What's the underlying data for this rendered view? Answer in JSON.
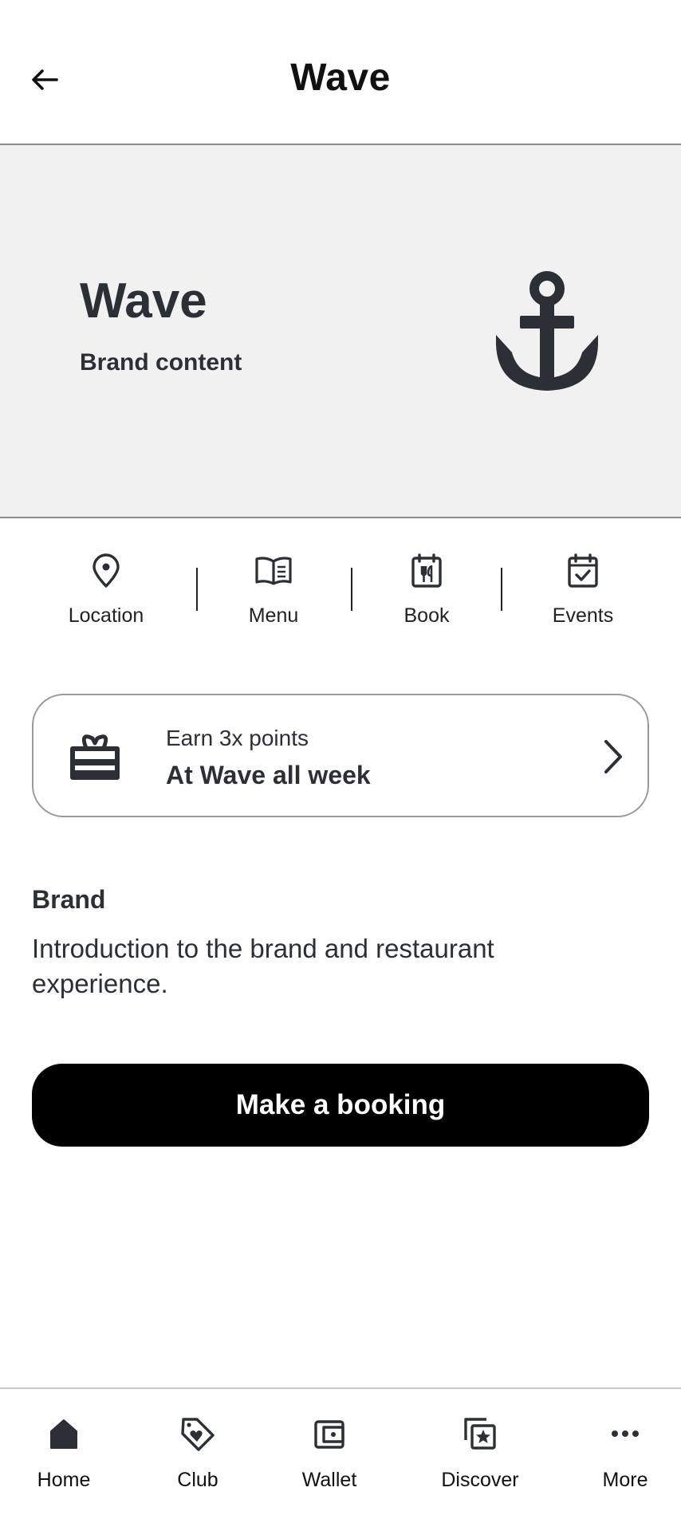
{
  "header": {
    "title": "Wave",
    "back_icon": "arrow-left-icon"
  },
  "hero": {
    "title": "Wave",
    "subtitle": "Brand content",
    "icon": "anchor-icon",
    "background": "#f1f1f1"
  },
  "actions": [
    {
      "label": "Location",
      "icon": "map-pin-icon"
    },
    {
      "label": "Menu",
      "icon": "open-book-icon"
    },
    {
      "label": "Book",
      "icon": "calendar-cutlery-icon"
    },
    {
      "label": "Events",
      "icon": "calendar-check-icon"
    }
  ],
  "promo": {
    "line1": "Earn 3x points",
    "line2": "At Wave all week",
    "icon": "gift-card-icon",
    "chevron_icon": "chevron-right-icon"
  },
  "brand_section": {
    "heading": "Brand",
    "body": "Introduction to the brand and restaurant experience."
  },
  "booking_button": {
    "label": "Make a booking",
    "background": "#000000"
  },
  "bottom_nav": [
    {
      "label": "Home",
      "icon": "home-icon"
    },
    {
      "label": "Club",
      "icon": "heart-tag-icon"
    },
    {
      "label": "Wallet",
      "icon": "wallet-icon"
    },
    {
      "label": "Discover",
      "icon": "star-cards-icon"
    },
    {
      "label": "More",
      "icon": "more-dots-icon"
    }
  ],
  "colors": {
    "text": "#2c3036",
    "border": "#8c8c8c"
  }
}
